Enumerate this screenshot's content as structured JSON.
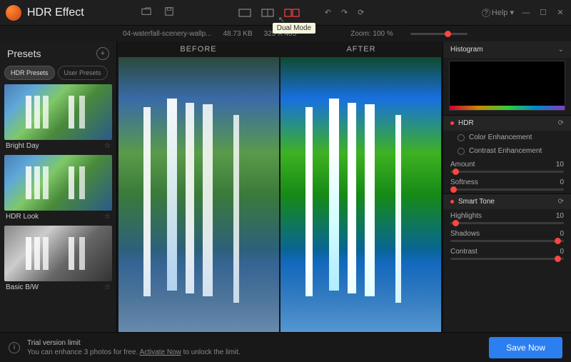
{
  "app": {
    "title": "HDR Effect",
    "help": "Help"
  },
  "tooltip": "Dual Mode",
  "file": {
    "name": "04-waterfall-scenery-wallp...",
    "size": "48.73 KB",
    "dims": "325 X 485"
  },
  "zoom": {
    "label": "Zoom:",
    "value": "100 %"
  },
  "ba": {
    "before": "BEFORE",
    "after": "AFTER"
  },
  "presets": {
    "title": "Presets",
    "tabs": [
      "HDR Presets",
      "User Presets"
    ],
    "items": [
      {
        "label": "Bright Day"
      },
      {
        "label": "HDR Look"
      },
      {
        "label": "Basic B/W"
      }
    ]
  },
  "right": {
    "histogram": "Histogram",
    "hdr": {
      "title": "HDR",
      "opt1": "Color Enhancement",
      "opt2": "Contrast Enhancement",
      "amount_l": "Amount",
      "amount_v": "10",
      "soft_l": "Softness",
      "soft_v": "0"
    },
    "smart": {
      "title": "Smart Tone",
      "hi_l": "Highlights",
      "hi_v": "10",
      "sh_l": "Shadows",
      "sh_v": "0",
      "co_l": "Contrast",
      "co_v": "0"
    }
  },
  "footer": {
    "title": "Trial version limit",
    "sub1": "You can enhance 3 photos for free. ",
    "link": "Activate Now",
    "sub2": " to unlock the limit.",
    "save": "Save Now"
  }
}
